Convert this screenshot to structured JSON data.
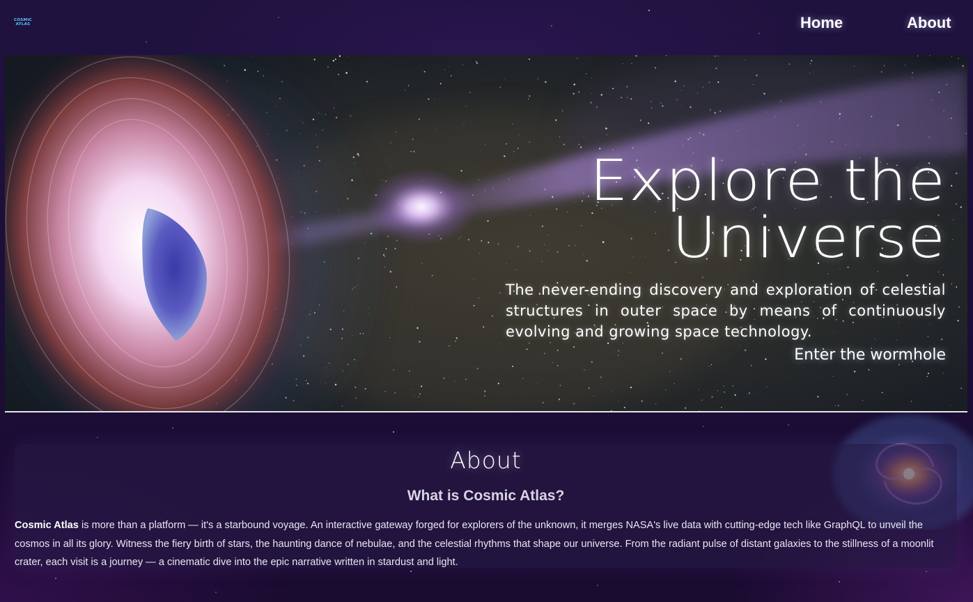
{
  "header": {
    "logo_line1": "COSMIC",
    "logo_line2": "ATLAS",
    "nav": [
      {
        "label": "Home"
      },
      {
        "label": "About"
      }
    ]
  },
  "hero": {
    "title_line1": "Explore the",
    "title_line2": "Universe",
    "description": "The never-ending discovery and exploration of celestial structures in outer space by means of continuously evolving and growing space technology.",
    "cta": "Enter the wormhole"
  },
  "about": {
    "heading": "About",
    "subheading": "What is Cosmic Atlas?",
    "brand": "Cosmic Atlas",
    "body": " is more than a platform — it's a starbound voyage. An interactive gateway forged for explorers of the unknown, it merges NASA's live data with cutting-edge tech like GraphQL to unveil the cosmos in all its glory. Witness the fiery birth of stars, the haunting dance of nebulae, and the celestial rhythms that shape our universe. From the radiant pulse of distant galaxies to the stillness of a moonlit crater, each visit is a journey — a cinematic dive into the epic narrative written in stardust and light."
  },
  "colors": {
    "page_background": "#1c0f38",
    "logo_accent": "#5bc7ff",
    "text": "#ffffff",
    "hero_divider": "#e6e6ee"
  },
  "icons": {
    "hero_image": "wormhole-space-image",
    "decor_image": "spiral-galaxy-image",
    "logo": "cosmic-atlas-logo"
  }
}
